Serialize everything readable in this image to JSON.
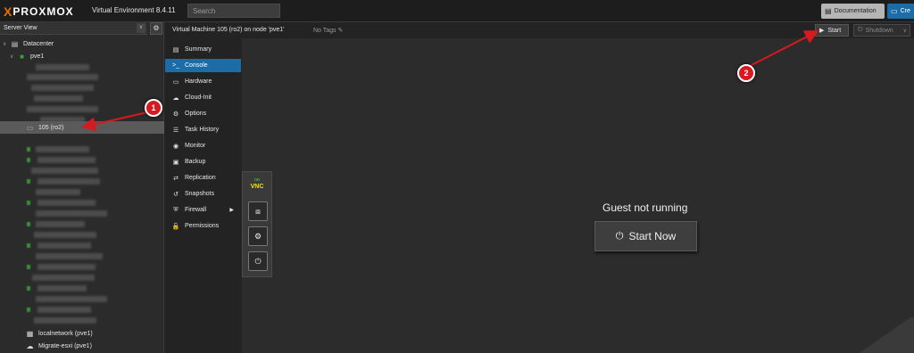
{
  "topbar": {
    "logo_x": "X",
    "logo_text": "PROXMOX",
    "version": "Virtual Environment 8.4.11",
    "search_placeholder": "Search",
    "documentation_label": "Documentation",
    "create_label": "Cre",
    "accent": "#e57000"
  },
  "sidebar": {
    "view_label": "Server View",
    "datacenter": "Datacenter",
    "node": "pve1",
    "selected_vm": "105 (ro2)",
    "storage_items": [
      "localnetwork (pve1)",
      "Migrate-esxi (pve1)"
    ]
  },
  "header": {
    "vm_title": "Virtual Machine 105 (ro2) on node 'pve1'",
    "tags": "No Tags",
    "start_label": "Start",
    "shutdown_label": "Shutdown"
  },
  "nav": {
    "items": [
      {
        "label": "Summary",
        "icon": "book-icon"
      },
      {
        "label": "Console",
        "icon": "terminal-icon"
      },
      {
        "label": "Hardware",
        "icon": "monitor-icon"
      },
      {
        "label": "Cloud-Init",
        "icon": "cloud-icon"
      },
      {
        "label": "Options",
        "icon": "gear-icon"
      },
      {
        "label": "Task History",
        "icon": "list-icon"
      },
      {
        "label": "Monitor",
        "icon": "eye-icon"
      },
      {
        "label": "Backup",
        "icon": "floppy-icon"
      },
      {
        "label": "Replication",
        "icon": "retweet-icon"
      },
      {
        "label": "Snapshots",
        "icon": "history-icon"
      },
      {
        "label": "Firewall",
        "icon": "shield-icon"
      },
      {
        "label": "Permissions",
        "icon": "unlock-icon"
      }
    ],
    "active": "Console"
  },
  "console": {
    "vnc_logo_top": "no",
    "vnc_logo": "VNC",
    "message": "Guest not running",
    "start_now_label": "Start Now"
  },
  "annotations": {
    "badge_1": "1",
    "badge_2": "2",
    "color": "#d71920"
  }
}
